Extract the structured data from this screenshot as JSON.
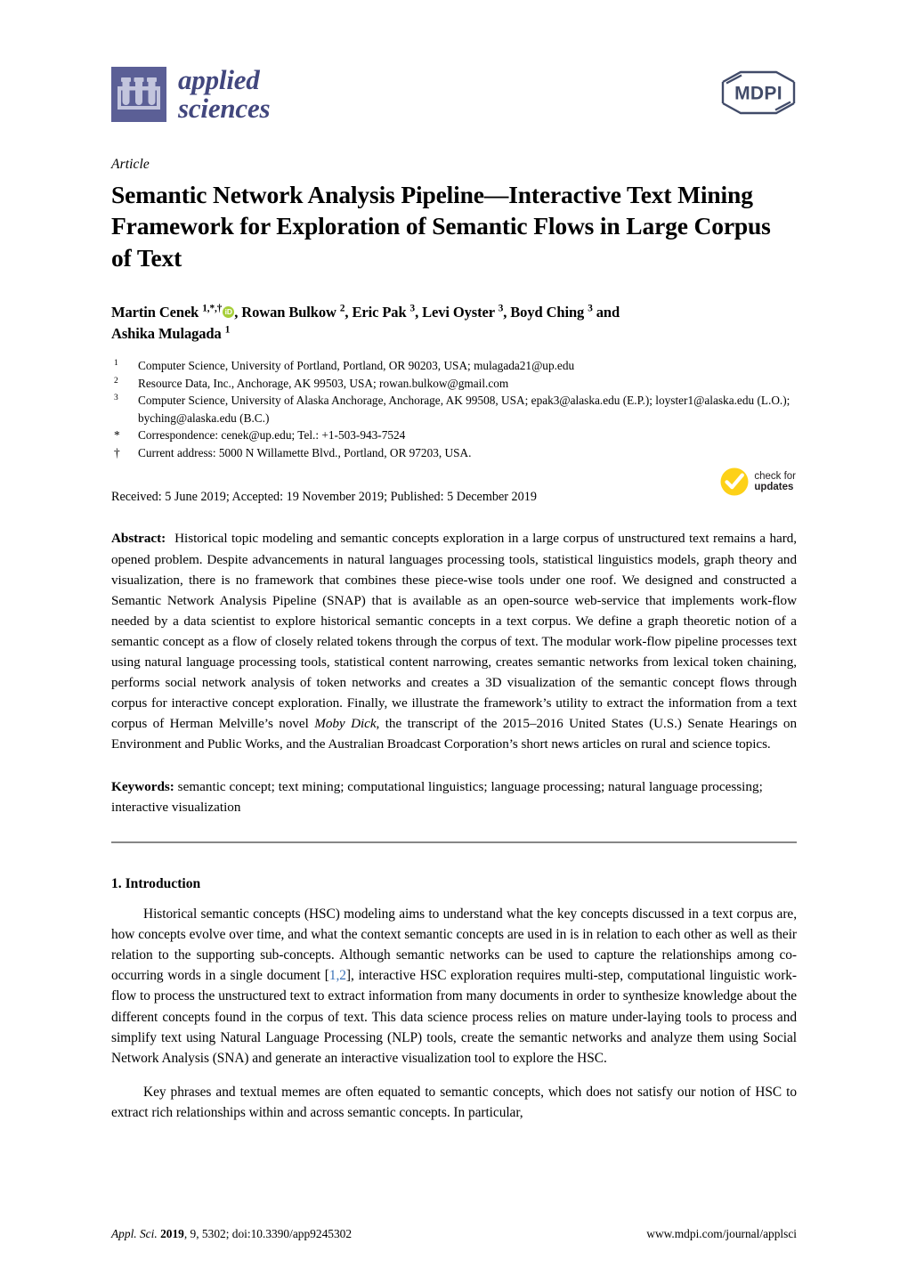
{
  "journal": {
    "name_line1": "applied",
    "name_line2": "sciences",
    "logo_icon": "test-tube-rack-icon",
    "publisher_logo_text": "MDPI",
    "brand_color": "#5b5f96",
    "wordmark_color": "#42477e"
  },
  "article": {
    "type": "Article",
    "title": "Semantic Network Analysis Pipeline—Interactive Text Mining Framework for Exploration of Semantic Flows in Large Corpus of Text"
  },
  "authors": {
    "line1_parts": [
      {
        "name": "Martin Cenek",
        "sup": "1,*,†",
        "orcid": true
      },
      {
        "name": "Rowan Bulkow",
        "sup": "2",
        "orcid": false
      },
      {
        "name": "Eric Pak",
        "sup": "3",
        "orcid": false
      },
      {
        "name": "Levi Oyster",
        "sup": "3",
        "orcid": false
      },
      {
        "name": "Boyd Ching",
        "sup": "3",
        "orcid": false
      }
    ],
    "conjunction": "and",
    "line2_name": "Ashika Mulagada",
    "line2_sup": "1",
    "orcid_label": "iD",
    "orcid_color": "#a6ce39"
  },
  "affiliations": [
    {
      "marker": "1",
      "type": "num",
      "text": "Computer Science, University of Portland, Portland, OR 90203, USA; mulagada21@up.edu"
    },
    {
      "marker": "2",
      "type": "num",
      "text": "Resource Data, Inc., Anchorage, AK 99503, USA; rowan.bulkow@gmail.com"
    },
    {
      "marker": "3",
      "type": "num",
      "text": "Computer Science, University of Alaska Anchorage, Anchorage, AK 99508, USA; epak3@alaska.edu (E.P.); loyster1@alaska.edu (L.O.); byching@alaska.edu (B.C.)"
    },
    {
      "marker": "*",
      "type": "sym",
      "text": "Correspondence: cenek@up.edu; Tel.: +1-503-943-7524"
    },
    {
      "marker": "†",
      "type": "sym",
      "text": "Current address: 5000 N Willamette Blvd., Portland, OR 97203, USA."
    }
  ],
  "dates": {
    "line": "Received: 5 June 2019; Accepted: 19 November 2019; Published: 5 December 2019"
  },
  "updates_badge": {
    "icon": "check-circle-icon",
    "line1": "check for",
    "line2": "updates",
    "color": "#fdd118"
  },
  "abstract": {
    "label": "Abstract:",
    "part1": "Historical topic modeling and semantic concepts exploration in a large corpus of unstructured text remains a hard, opened problem. Despite advancements in natural languages processing tools, statistical linguistics models, graph theory and visualization, there is no framework that combines these piece-wise tools under one roof. We designed and constructed a Semantic Network Analysis Pipeline (SNAP) that is available as an open-source web-service that implements work-flow needed by a data scientist to explore historical semantic concepts in a text corpus. We define a graph theoretic notion of a semantic concept as a flow of closely related tokens through the corpus of text. The modular work-flow pipeline processes text using natural language processing tools, statistical content narrowing, creates semantic networks from lexical token chaining, performs social network analysis of token networks and creates a 3D visualization of the semantic concept flows through corpus for interactive concept exploration. Finally, we illustrate the framework’s utility to extract the information from a text corpus of Herman Melville’s novel ",
    "italic1": "Moby Dick",
    "part2": ", the transcript of the 2015–2016 United States (U.S.) Senate Hearings on Environment and Public Works, and the Australian Broadcast Corporation’s short news articles on rural and science topics."
  },
  "keywords": {
    "label": "Keywords:",
    "text": "semantic concept; text mining; computational linguistics; language processing; natural language processing; interactive visualization"
  },
  "sections": [
    {
      "heading": "1. Introduction",
      "paragraphs": [
        {
          "indent": true,
          "pre_cite": "Historical semantic concepts (HSC) modeling aims to understand what the key concepts discussed in a text corpus are, how concepts evolve over time, and what the context semantic concepts are used in is in relation to each other as well as their relation to the supporting sub-concepts. Although semantic networks can be used to capture the relationships among co-occurring words in a single document [",
          "citation": "1,2",
          "post_cite": "], interactive HSC exploration requires multi-step, computational linguistic work-flow to process the unstructured text to extract information from many documents in order to synthesize knowledge about the different concepts found in the corpus of text. This data science process relies on mature under-laying tools to process and simplify text using Natural Language Processing (NLP) tools, create the semantic networks and analyze them using Social Network Analysis (SNA) and generate an interactive visualization tool to explore the HSC."
        },
        {
          "indent": true,
          "pre_cite": "Key phrases and textual memes are often equated to semantic concepts, which does not satisfy our notion of HSC to extract rich relationships within and across semantic concepts. In particular,",
          "citation": "",
          "post_cite": ""
        }
      ]
    }
  ],
  "footer": {
    "journal_abbrev": "Appl. Sci.",
    "year": "2019",
    "volume_issue": ", 9, 5302; doi:10.3390/app9245302",
    "url": "www.mdpi.com/journal/applsci"
  },
  "citation_color": "#3a72b8"
}
